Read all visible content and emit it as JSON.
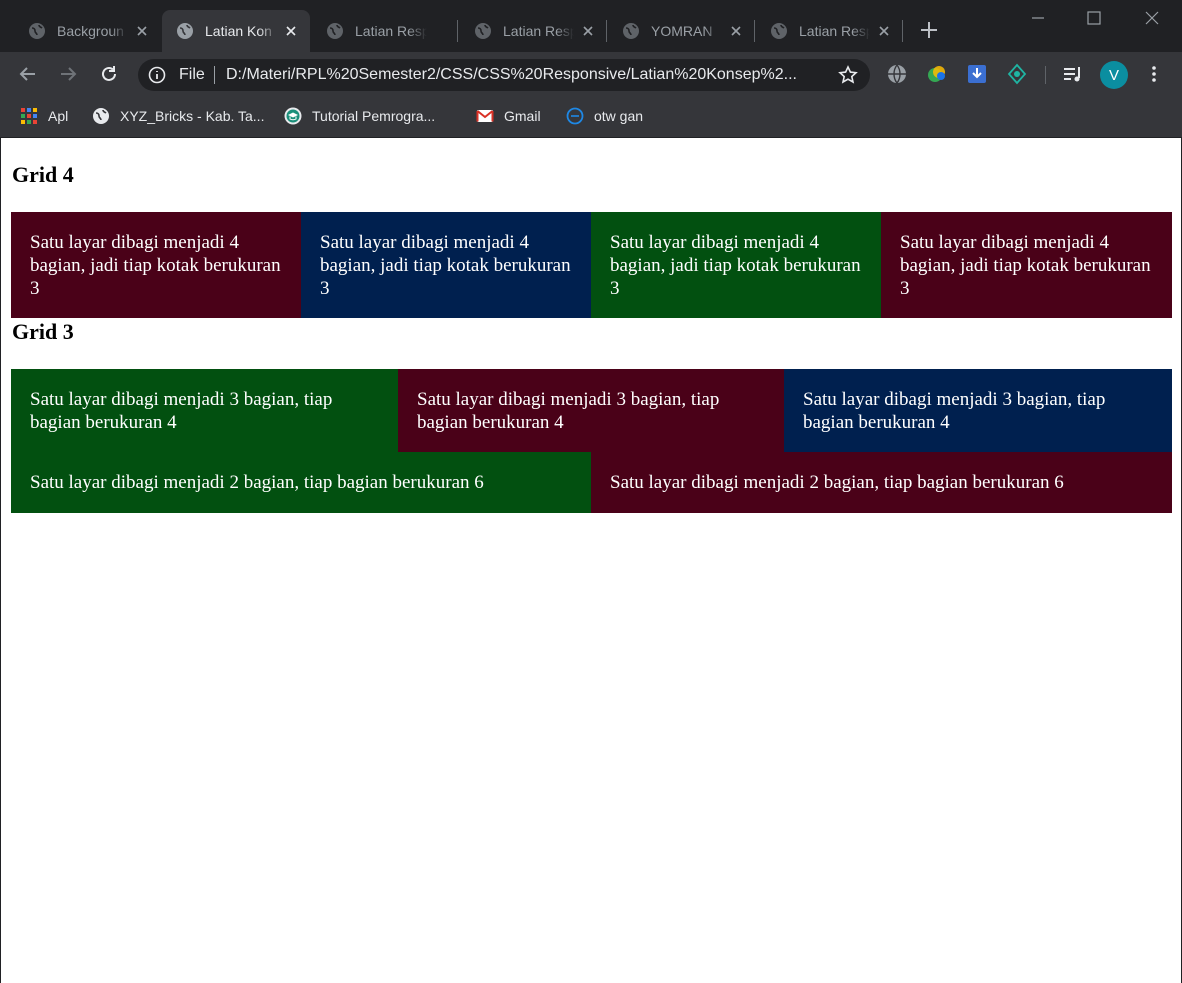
{
  "browser": {
    "tabs": [
      {
        "title": "Backgroun",
        "active": false
      },
      {
        "title": "Latian Kon",
        "active": true
      },
      {
        "title": "Latian Resp",
        "active": false
      },
      {
        "title": "Latian Resp",
        "active": false
      },
      {
        "title": "YOMRAN",
        "active": false
      },
      {
        "title": "Latian Resp",
        "active": false
      }
    ],
    "address": {
      "scheme_label": "File",
      "url": "D:/Materi/RPL%20Semester2/CSS/CSS%20Responsive/Latian%20Konsep%2..."
    },
    "profile_initial": "V",
    "bookmarks": [
      {
        "label": "Apl",
        "icon": "apps-grid-icon"
      },
      {
        "label": "XYZ_Bricks - Kab. Ta...",
        "icon": "globe-icon"
      },
      {
        "label": "Tutorial Pemrogra...",
        "icon": "graduation-cap-icon"
      },
      {
        "label": "Gmail",
        "icon": "gmail-icon"
      },
      {
        "label": "otw gan",
        "icon": "dell-icon"
      }
    ]
  },
  "page": {
    "grid4": {
      "heading": "Grid 4",
      "cells": [
        {
          "text": "Satu layar dibagi menjadi 4 bagian, jadi tiap kotak berukuran 3",
          "color": "#4a0118"
        },
        {
          "text": "Satu layar dibagi menjadi 4 bagian, jadi tiap kotak berukuran 3",
          "color": "#00204f"
        },
        {
          "text": "Satu layar dibagi menjadi 4 bagian, jadi tiap kotak berukuran 3",
          "color": "#025010"
        },
        {
          "text": "Satu layar dibagi menjadi 4 bagian, jadi tiap kotak berukuran 3",
          "color": "#4a0118"
        }
      ]
    },
    "grid3": {
      "heading": "Grid 3",
      "cells": [
        {
          "text": "Satu layar dibagi menjadi 3 bagian, tiap bagian berukuran 4",
          "color": "#025010"
        },
        {
          "text": "Satu layar dibagi menjadi 3 bagian, tiap bagian berukuran 4",
          "color": "#4a0118"
        },
        {
          "text": "Satu layar dibagi menjadi 3 bagian, tiap bagian berukuran 4",
          "color": "#00204f"
        }
      ]
    },
    "grid2": {
      "cells": [
        {
          "text": "Satu layar dibagi menjadi 2 bagian, tiap bagian berukuran 6",
          "color": "#025010"
        },
        {
          "text": "Satu layar dibagi menjadi 2 bagian, tiap bagian berukuran 6",
          "color": "#4a0118"
        }
      ]
    }
  }
}
